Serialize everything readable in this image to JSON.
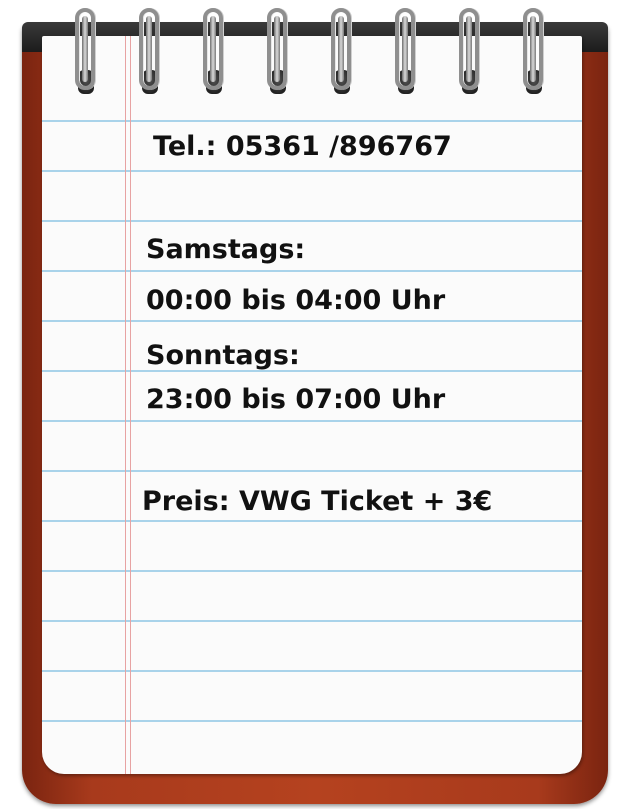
{
  "note": {
    "phone": "Tel.: 05361 /896767",
    "saturday_label": "Samstags:",
    "saturday_hours": "00:00 bis 04:00 Uhr",
    "sunday_label": "Sonntags:",
    "sunday_hours": "23:00 bis 07:00 Uhr",
    "price": "Preis: VWG Ticket + 3€"
  },
  "colors": {
    "cover": "#b5421f",
    "paper": "#fbfbfb",
    "rule_line": "#a9d3ea",
    "margin_line": "#e7a2a2",
    "text": "#111111"
  },
  "icons": {
    "spiral_ring": "spiral-ring-icon"
  }
}
